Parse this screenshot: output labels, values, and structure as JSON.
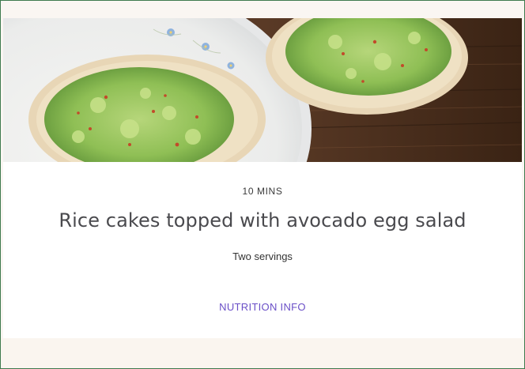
{
  "recipe": {
    "time": "10 MINS",
    "title": "Rice cakes topped with avocado egg salad",
    "servings": "Two servings",
    "nutrition_link": "NUTRITION INFO"
  },
  "colors": {
    "link": "#6a4fc7",
    "title": "#4a4a4e",
    "frame_border": "#3f7a4e",
    "background": "#faf6f2"
  }
}
